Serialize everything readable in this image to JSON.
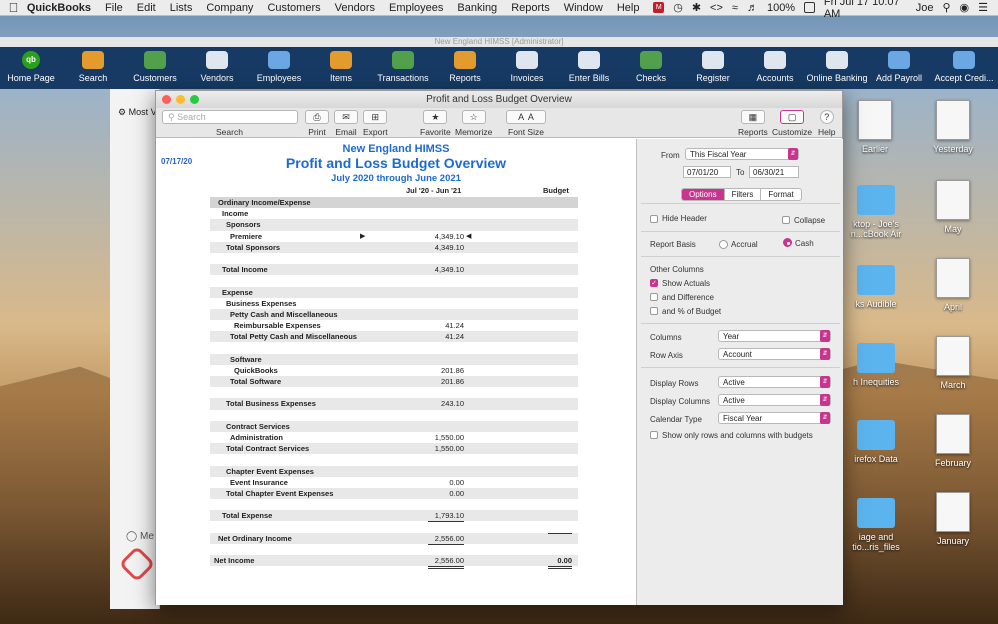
{
  "menubar": {
    "app": "QuickBooks",
    "items": [
      "File",
      "Edit",
      "Lists",
      "Company",
      "Customers",
      "Vendors",
      "Employees",
      "Banking",
      "Reports",
      "Window",
      "Help"
    ],
    "battery": "100%",
    "clock": "Fri Jul 17  10:07 AM",
    "user": "Joe"
  },
  "app_title": "New England HIMSS [Administrator]",
  "iconbar": [
    {
      "label": "Home Page"
    },
    {
      "label": "Search"
    },
    {
      "label": "Customers"
    },
    {
      "label": "Vendors"
    },
    {
      "label": "Employees"
    },
    {
      "label": "Items"
    },
    {
      "label": "Transactions"
    },
    {
      "label": "Reports"
    },
    {
      "label": "Invoices"
    },
    {
      "label": "Enter Bills"
    },
    {
      "label": "Checks"
    },
    {
      "label": "Register"
    },
    {
      "label": "Accounts"
    },
    {
      "label": "Online Banking"
    },
    {
      "label": "Add Payroll"
    },
    {
      "label": "Accept Credi..."
    }
  ],
  "bg_window": {
    "most": "Most V",
    "me": "Me"
  },
  "desktop": {
    "earlier": "Earlier",
    "yesterday": "Yesterday",
    "joe1": "ktop - Joe's",
    "joe2": "n...cBook Air",
    "may": "May",
    "audible": "ks Audible",
    "april": "April",
    "inequities": "h Inequities",
    "march": "March",
    "firefox": "irefox Data",
    "february": "February",
    "files1": "iage and",
    "files2": "tio...ris_files",
    "january": "January"
  },
  "window": {
    "title": "Profit and Loss Budget Overview",
    "search_placeholder": "Search",
    "toolbar": {
      "search": "Search",
      "print": "Print",
      "email": "Email",
      "export": "Export",
      "favorite": "Favorite",
      "memorize": "Memorize",
      "font_size": "Font Size",
      "reports": "Reports",
      "customize": "Customize",
      "help": "Help"
    }
  },
  "report": {
    "date": "07/17/20",
    "company": "New England HIMSS",
    "title": "Profit and Loss Budget Overview",
    "subtitle": "July 2020 through June 2021",
    "col1": "Jul '20 - Jun '21",
    "col2": "Budget",
    "rows": [
      {
        "label": "Ordinary Income/Expense",
        "indent": 2,
        "value": "",
        "budget": ""
      },
      {
        "label": "Income",
        "indent": 6,
        "value": "",
        "budget": ""
      },
      {
        "label": "Sponsors",
        "indent": 10,
        "value": "",
        "budget": ""
      },
      {
        "label": "Premiere",
        "indent": 14,
        "value": "4,349.10",
        "budget": ""
      },
      {
        "label": "Total Sponsors",
        "indent": 10,
        "value": "4,349.10",
        "budget": ""
      },
      {
        "label": "",
        "indent": 0,
        "value": "",
        "budget": ""
      },
      {
        "label": "Total Income",
        "indent": 6,
        "value": "4,349.10",
        "budget": ""
      },
      {
        "label": "",
        "indent": 0,
        "value": "",
        "budget": ""
      },
      {
        "label": "Expense",
        "indent": 6,
        "value": "",
        "budget": ""
      },
      {
        "label": "Business Expenses",
        "indent": 10,
        "value": "",
        "budget": ""
      },
      {
        "label": "Petty Cash and Miscellaneous",
        "indent": 14,
        "value": "",
        "budget": ""
      },
      {
        "label": "Reimbursable Expenses",
        "indent": 18,
        "value": "41.24",
        "budget": ""
      },
      {
        "label": "Total Petty Cash and Miscellaneous",
        "indent": 14,
        "value": "41.24",
        "budget": ""
      },
      {
        "label": "",
        "indent": 0,
        "value": "",
        "budget": ""
      },
      {
        "label": "Software",
        "indent": 14,
        "value": "",
        "budget": ""
      },
      {
        "label": "QuickBooks",
        "indent": 18,
        "value": "201.86",
        "budget": ""
      },
      {
        "label": "Total Software",
        "indent": 14,
        "value": "201.86",
        "budget": ""
      },
      {
        "label": "",
        "indent": 0,
        "value": "",
        "budget": ""
      },
      {
        "label": "Total Business Expenses",
        "indent": 10,
        "value": "243.10",
        "budget": ""
      },
      {
        "label": "",
        "indent": 0,
        "value": "",
        "budget": ""
      },
      {
        "label": "Contract Services",
        "indent": 10,
        "value": "",
        "budget": ""
      },
      {
        "label": "Administration",
        "indent": 14,
        "value": "1,550.00",
        "budget": ""
      },
      {
        "label": "Total Contract Services",
        "indent": 10,
        "value": "1,550.00",
        "budget": ""
      },
      {
        "label": "",
        "indent": 0,
        "value": "",
        "budget": ""
      },
      {
        "label": "Chapter Event Expenses",
        "indent": 10,
        "value": "",
        "budget": ""
      },
      {
        "label": "Event Insurance",
        "indent": 14,
        "value": "0.00",
        "budget": ""
      },
      {
        "label": "Total Chapter Event Expenses",
        "indent": 10,
        "value": "0.00",
        "budget": ""
      },
      {
        "label": "",
        "indent": 0,
        "value": "",
        "budget": ""
      },
      {
        "label": "Total Expense",
        "indent": 6,
        "value": "1,793.10",
        "budget": ""
      },
      {
        "label": "",
        "indent": 0,
        "value": "",
        "budget": ""
      },
      {
        "label": "Net Ordinary Income",
        "indent": 2,
        "value": "2,556.00",
        "budget": ""
      },
      {
        "label": "",
        "indent": 0,
        "value": "",
        "budget": ""
      },
      {
        "label": "Net Income",
        "indent": -2,
        "value": "2,556.00",
        "budget": "0.00"
      }
    ]
  },
  "panel": {
    "from_label": "From",
    "from_select": "This Fiscal Year",
    "from_date": "07/01/20",
    "to_label": "To",
    "to_date": "06/30/21",
    "tabs": [
      "Options",
      "Filters",
      "Format"
    ],
    "hide_header": "Hide Header",
    "collapse": "Collapse",
    "report_basis": "Report Basis",
    "accrual": "Accrual",
    "cash": "Cash",
    "other_columns": "Other Columns",
    "show_actuals": "Show Actuals",
    "and_difference": "and Difference",
    "and_pct_budget": "and % of Budget",
    "columns_label": "Columns",
    "columns_value": "Year",
    "row_axis_label": "Row Axis",
    "row_axis_value": "Account",
    "display_rows_label": "Display Rows",
    "display_rows_value": "Active",
    "display_columns_label": "Display Columns",
    "display_columns_value": "Active",
    "calendar_type_label": "Calendar Type",
    "calendar_type_value": "Fiscal Year",
    "show_only": "Show only rows and columns with budgets"
  }
}
